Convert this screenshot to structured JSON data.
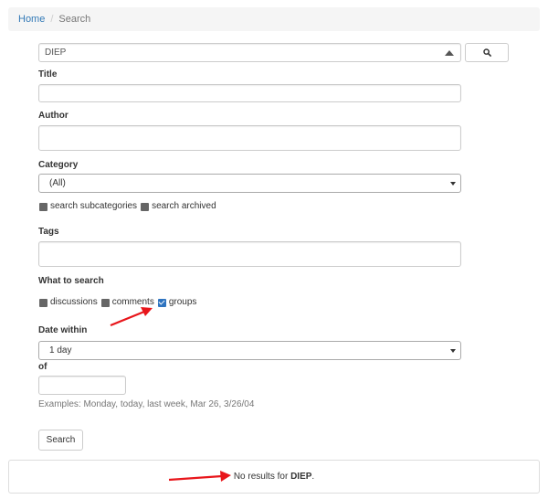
{
  "breadcrumb": {
    "home": "Home",
    "separator": "/",
    "current": "Search"
  },
  "search": {
    "query_value": "DIEP",
    "button_icon": "search-icon"
  },
  "form": {
    "title_label": "Title",
    "title_value": "",
    "author_label": "Author",
    "author_value": "",
    "category_label": "Category",
    "category_selected": "(All)",
    "category_options": [
      {
        "label": "search subcategories",
        "checked": false
      },
      {
        "label": "search archived",
        "checked": false
      }
    ],
    "tags_label": "Tags",
    "tags_value": "",
    "what_label": "What to search",
    "what_options": [
      {
        "label": "discussions",
        "checked": false
      },
      {
        "label": "comments",
        "checked": false
      },
      {
        "label": "groups",
        "checked": true
      }
    ],
    "date_within_label": "Date within",
    "date_within_selected": "1 day",
    "of_label": "of",
    "of_value": "",
    "examples": "Examples: Monday, today, last week, Mar 26, 3/26/04",
    "submit_label": "Search"
  },
  "results": {
    "prefix": "No results for",
    "term": "DIEP",
    "suffix": "."
  },
  "annotations": {
    "arrow_color": "#e8161b"
  },
  "colors": {
    "link": "#337ab7",
    "checkbox_checked": "#2f74c0",
    "checkbox_unchecked": "#666666"
  }
}
